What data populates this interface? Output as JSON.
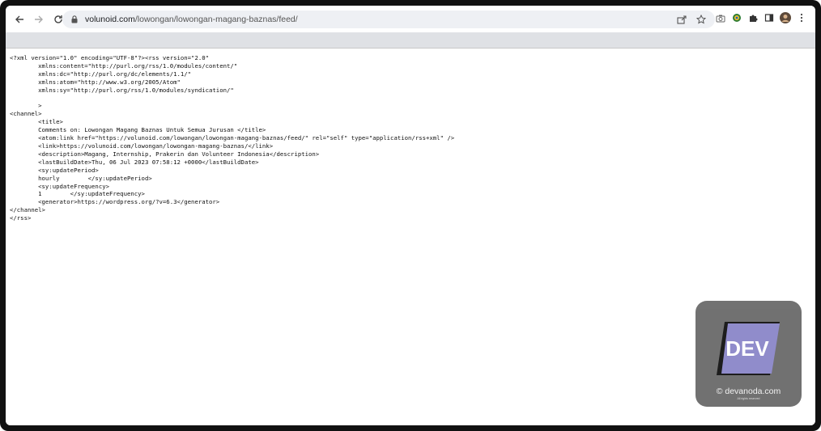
{
  "browser": {
    "url_host": "volunoid.com",
    "url_path": "/lowongan/lowongan-magang-baznas/feed/"
  },
  "icons": {
    "back": "arrow-left-icon",
    "forward": "arrow-right-icon",
    "reload": "reload-icon",
    "lock": "lock-icon",
    "share": "share-icon",
    "bookmark": "star-icon",
    "camera": "camera-icon",
    "extension_color": "colorful-extension-icon",
    "extensions": "puzzle-icon",
    "sidebar": "side-panel-icon",
    "profile": "avatar",
    "menu": "kebab-menu-icon"
  },
  "xml_lines": [
    "<?xml version=\"1.0\" encoding=\"UTF-8\"?><rss version=\"2.0\"",
    "\txmlns:content=\"http://purl.org/rss/1.0/modules/content/\"",
    "\txmlns:dc=\"http://purl.org/dc/elements/1.1/\"",
    "\txmlns:atom=\"http://www.w3.org/2005/Atom\"",
    "\txmlns:sy=\"http://purl.org/rss/1.0/modules/syndication/\"",
    "\t",
    "\t>",
    "<channel>",
    "\t<title>",
    "\tComments on: Lowongan Magang Baznas Untuk Semua Jurusan </title>",
    "\t<atom:link href=\"https://volunoid.com/lowongan/lowongan-magang-baznas/feed/\" rel=\"self\" type=\"application/rss+xml\" />",
    "\t<link>https://volunoid.com/lowongan/lowongan-magang-baznas/</link>",
    "\t<description>Magang, Internship, Prakerin dan Volunteer Indonesia</description>",
    "\t<lastBuildDate>Thu, 06 Jul 2023 07:58:12 +0000</lastBuildDate>",
    "\t<sy:updatePeriod>",
    "\thourly\t</sy:updatePeriod>",
    "\t<sy:updateFrequency>",
    "\t1\t</sy:updateFrequency>",
    "\t<generator>https://wordpress.org/?v=6.3</generator>",
    "</channel>",
    "</rss>"
  ],
  "watermark": {
    "logo_text": "DEV",
    "text": "© devanoda.com",
    "subtext": "All rights reserved",
    "accent": "#8b86c9"
  }
}
